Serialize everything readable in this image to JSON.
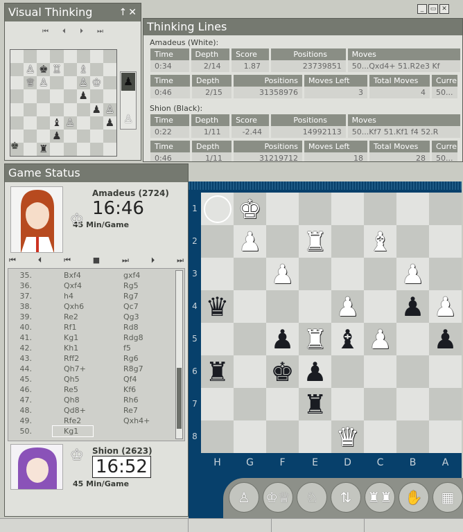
{
  "visual": {
    "title": "Visual Thinking",
    "buttons": [
      "⏮",
      "⏴",
      "⏵",
      "⏭"
    ],
    "mini_board": [
      [
        "",
        "",
        "",
        "",
        "",
        "",
        "",
        ""
      ],
      [
        "",
        "♙",
        "♚",
        "♖",
        "",
        "♗",
        "",
        ""
      ],
      [
        "",
        "♕",
        "♙",
        "",
        "",
        "♙",
        "♔",
        ""
      ],
      [
        "",
        "",
        "",
        "",
        "",
        "♟",
        "",
        ""
      ],
      [
        "",
        "",
        "",
        "",
        "",
        "",
        "♟",
        "♙"
      ],
      [
        "",
        "",
        "",
        "♝",
        "♙",
        "",
        "",
        "♟"
      ],
      [
        "",
        "",
        "",
        "♟",
        "",
        "",
        "",
        ""
      ],
      [
        "",
        "",
        "♜",
        "",
        "",
        "",
        "",
        ""
      ]
    ]
  },
  "thinking": {
    "title": "Thinking Lines",
    "white_label": "Amadeus (White):",
    "black_label": "Shion (Black):",
    "h1": [
      "Time",
      "Depth",
      "Score",
      "Positions",
      "Moves"
    ],
    "h2": [
      "Time",
      "Depth",
      "Positions",
      "Moves Left",
      "Total Moves",
      "Curre"
    ],
    "w1": [
      "0:34",
      "2/14",
      "1.87",
      "23739851",
      "50...Qxd4+ 51.R2e3 Kf"
    ],
    "w2": [
      "0:46",
      "2/15",
      "31358976",
      "3",
      "4",
      "50..."
    ],
    "b1": [
      "0:22",
      "1/11",
      "-2.44",
      "14992113",
      "50...Kf7 51.Kf1 f4 52.R"
    ],
    "b2": [
      "0:46",
      "1/11",
      "31219712",
      "18",
      "28",
      "50..."
    ]
  },
  "status": {
    "title": "Game Status",
    "white_name": "Amadeus (2724)",
    "white_clock": "16:46",
    "white_mode": "45 Min/Game",
    "black_name": "Shion (2623)",
    "black_clock": "16:52",
    "black_mode": "45 Min/Game",
    "nav": [
      "⏮",
      "⏴",
      "⏮",
      "■",
      "⏭",
      "⏵",
      "⏭"
    ],
    "moves": [
      [
        "35.",
        "Bxf4",
        "gxf4"
      ],
      [
        "36.",
        "Qxf4",
        "Rg5"
      ],
      [
        "37.",
        "h4",
        "Rg7"
      ],
      [
        "38.",
        "Qxh6",
        "Qc7"
      ],
      [
        "39.",
        "Re2",
        "Qg3"
      ],
      [
        "40.",
        "Rf1",
        "Rd8"
      ],
      [
        "41.",
        "Kg1",
        "Rdg8"
      ],
      [
        "42.",
        "Kh1",
        "f5"
      ],
      [
        "43.",
        "Rff2",
        "Rg6"
      ],
      [
        "44.",
        "Qh7+",
        "R8g7"
      ],
      [
        "45.",
        "Qh5",
        "Qf4"
      ],
      [
        "46.",
        "Re5",
        "Kf6"
      ],
      [
        "47.",
        "Qh8",
        "Rh6"
      ],
      [
        "48.",
        "Qd8+",
        "Re7"
      ],
      [
        "49.",
        "Rfe2",
        "Qxh4+"
      ],
      [
        "50.",
        "Kg1",
        ""
      ]
    ]
  },
  "board": {
    "ranks": [
      "1",
      "2",
      "3",
      "4",
      "5",
      "6",
      "7",
      "8"
    ],
    "files": [
      "H",
      "G",
      "F",
      "E",
      "D",
      "C",
      "B",
      "A"
    ],
    "squares": [
      [
        "ring",
        "wK",
        "",
        "",
        "",
        "",
        "",
        ""
      ],
      [
        "",
        "wP",
        "",
        "wR",
        "",
        "wB",
        "",
        ""
      ],
      [
        "",
        "",
        "wP",
        "",
        "",
        "",
        "wP",
        ""
      ],
      [
        "bQ",
        "",
        "",
        "",
        "wP",
        "",
        "bP",
        "wP"
      ],
      [
        "",
        "",
        "bP",
        "wR",
        "bB",
        "wP",
        "",
        "bP"
      ],
      [
        "bR",
        "",
        "bK",
        "bP",
        "",
        "",
        "",
        ""
      ],
      [
        "",
        "",
        "",
        "bR",
        "",
        "",
        "",
        ""
      ],
      [
        "",
        "",
        "",
        "",
        "wQ",
        "",
        "",
        ""
      ]
    ]
  },
  "tools": [
    "♙",
    "♔♕",
    "♘",
    "⇅",
    "♜♜",
    "✋",
    "▦"
  ]
}
